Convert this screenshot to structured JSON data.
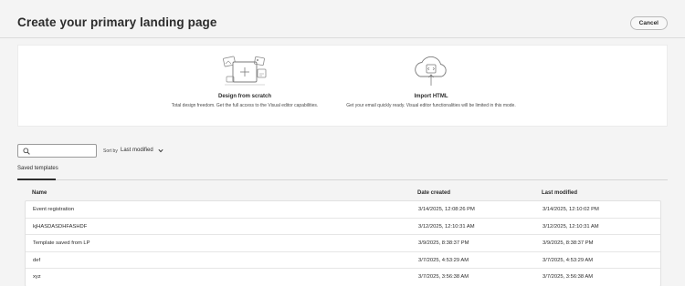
{
  "header": {
    "title": "Create your primary landing page",
    "cancel_label": "Cancel"
  },
  "choices": [
    {
      "title": "Design from scratch",
      "description": "Total design freedom. Get the full access to the Visual editor capabilities.",
      "icon": "design-canvas-icon"
    },
    {
      "title": "Import HTML",
      "description": "Get your email quickly ready. Visual editor functionalities will be limited in this mode.",
      "icon": "cloud-code-upload-icon"
    }
  ],
  "toolbar": {
    "search_placeholder": "",
    "sort_label": "Sort by",
    "sort_value": "Last modified"
  },
  "tabs": {
    "saved_templates": "Saved templates"
  },
  "table": {
    "columns": [
      "Name",
      "Date created",
      "Last modified"
    ],
    "rows": [
      {
        "name": "Event registration",
        "created": "3/14/2025, 12:08:26 PM",
        "modified": "3/14/2025, 12:10:02 PM"
      },
      {
        "name": "kjHASDASDHFASHDF",
        "created": "3/12/2025, 12:10:31 AM",
        "modified": "3/12/2025, 12:10:31 AM"
      },
      {
        "name": "Template saved from LP",
        "created": "3/9/2025, 8:38:37 PM",
        "modified": "3/9/2025, 8:38:37 PM"
      },
      {
        "name": "def",
        "created": "3/7/2025, 4:53:29 AM",
        "modified": "3/7/2025, 4:53:29 AM"
      },
      {
        "name": "xyz",
        "created": "3/7/2025, 3:56:38 AM",
        "modified": "3/7/2025, 3:56:38 AM"
      }
    ]
  },
  "colors": {
    "background": "#f4f4f4",
    "panel": "#ffffff",
    "text": "#2c2c2c"
  }
}
